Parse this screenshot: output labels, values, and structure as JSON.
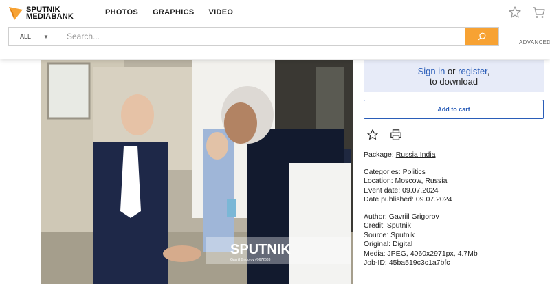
{
  "brand": {
    "line1": "SPUTNIK",
    "line2": "MEDIABANK",
    "accent": "#f7a233"
  },
  "nav": [
    {
      "label": "PHOTOS"
    },
    {
      "label": "GRAPHICS"
    },
    {
      "label": "VIDEO"
    }
  ],
  "header_icons": {
    "favorites": "star-outline-icon",
    "cart": "cart-icon"
  },
  "search": {
    "scope": "ALL",
    "placeholder": "Search...",
    "advanced_label": "ADVANCED",
    "button_icon": "search-icon"
  },
  "photo": {
    "watermark": "SPUTNIK",
    "watermark_credit": "Gavriil Grigorov #9672683"
  },
  "signin": {
    "signin_link": "Sign in",
    "or": "or",
    "register_link": "register",
    "comma": ",",
    "suffix": "to download"
  },
  "cart_button": {
    "label": "Add to cart"
  },
  "actions": {
    "favorite_icon": "star-outline-icon",
    "print_icon": "printer-icon"
  },
  "metadata": {
    "package_label": "Package:",
    "package_links": [
      "Russia India"
    ],
    "categories_label": "Categories:",
    "categories_links": [
      "Politics"
    ],
    "location_label": "Location:",
    "location_links": [
      "Moscow",
      "Russia"
    ],
    "event_date": "Event date: 09.07.2024",
    "date_published": "Date published: 09.07.2024",
    "author": "Author: Gavriil Grigorov",
    "credit": "Credit: Sputnik",
    "source": "Source: Sputnik",
    "original": "Original: Digital",
    "media": "Media: JPEG, 4060x2971px, 4.7Mb",
    "job_id": "Job-ID: 45ba519c3c1a7bfc"
  }
}
